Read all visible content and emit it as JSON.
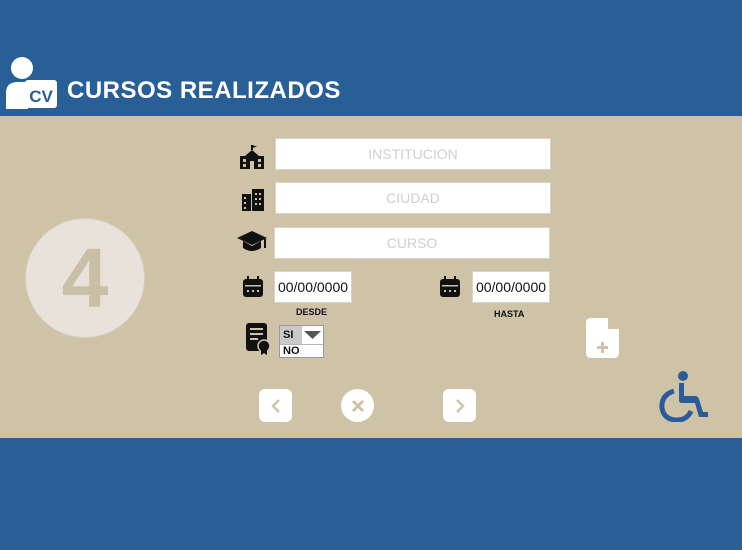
{
  "header": {
    "logo_text": "CV",
    "title": "CURSOS REALIZADOS"
  },
  "step": {
    "number": "4"
  },
  "form": {
    "institucion_placeholder": "INSTITUCION",
    "ciudad_placeholder": "CIUDAD",
    "curso_placeholder": "CURSO",
    "desde_value": "00/00/0000",
    "desde_label": "DESDE",
    "hasta_value": "00/00/0000",
    "hasta_label": "HASTA",
    "certificado_selected": "SI",
    "certificado_options": [
      "SI",
      "NO"
    ]
  },
  "icons": {
    "institucion": "school-icon",
    "ciudad": "city-icon",
    "curso": "graduation-cap-icon",
    "desde": "calendar-icon",
    "hasta": "calendar-icon",
    "certificado": "certificate-icon",
    "add_document": "file-plus-icon",
    "accessibility": "wheelchair-icon",
    "prev": "chevron-left-icon",
    "cancel": "close-icon",
    "next": "chevron-right-icon"
  },
  "colors": {
    "header_bg": "#285f97",
    "panel_bg": "#cfc3a7",
    "accent_blue": "#2a5d97"
  }
}
